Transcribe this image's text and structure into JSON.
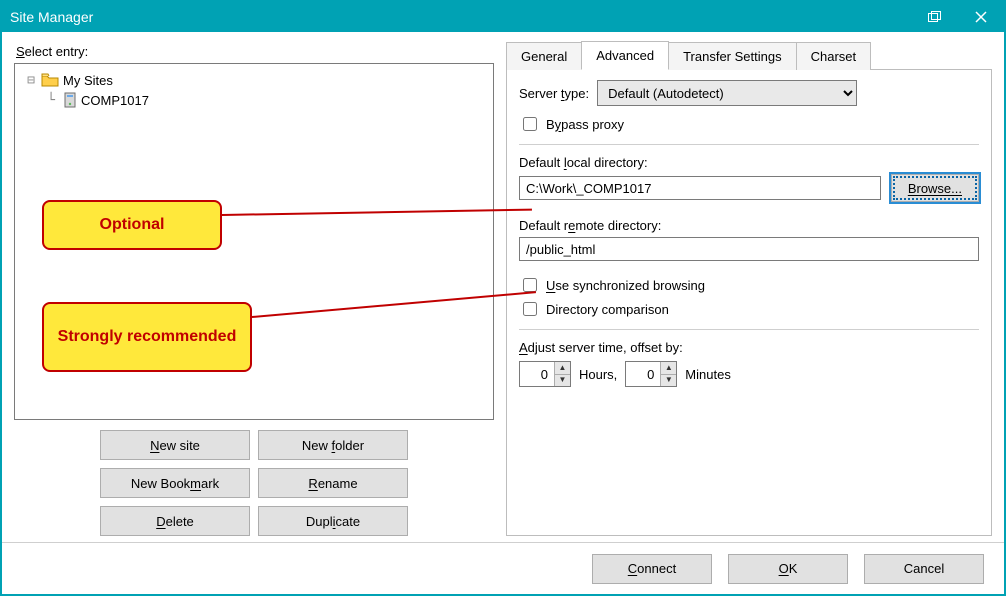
{
  "window": {
    "title": "Site Manager"
  },
  "left": {
    "select_label": "Select entry:",
    "tree": {
      "root_label": "My Sites",
      "child_label": "COMP1017"
    },
    "buttons": {
      "new_site": "New site",
      "new_folder": "New folder",
      "new_bookmark": "New Bookmark",
      "rename": "Rename",
      "delete": "Delete",
      "duplicate": "Duplicate"
    }
  },
  "tabs": {
    "general": "General",
    "advanced": "Advanced",
    "transfer": "Transfer Settings",
    "charset": "Charset",
    "active": "advanced"
  },
  "advanced": {
    "server_type_label": "Server type:",
    "server_type_value": "Default (Autodetect)",
    "bypass_proxy_label": "Bypass proxy",
    "bypass_proxy_checked": false,
    "local_dir_label": "Default local directory:",
    "local_dir_value": "C:\\Work\\_COMP1017",
    "browse_label": "Browse...",
    "remote_dir_label": "Default remote directory:",
    "remote_dir_value": "/public_html",
    "sync_browsing_label": "Use synchronized browsing",
    "sync_browsing_checked": false,
    "dir_compare_label": "Directory comparison",
    "dir_compare_checked": false,
    "adjust_time_label": "Adjust server time, offset by:",
    "hours_value": "0",
    "hours_label": "Hours,",
    "minutes_value": "0",
    "minutes_label": "Minutes"
  },
  "footer": {
    "connect": "Connect",
    "ok": "OK",
    "cancel": "Cancel"
  },
  "callouts": {
    "optional": "Optional",
    "strongly": "Strongly recommended"
  }
}
